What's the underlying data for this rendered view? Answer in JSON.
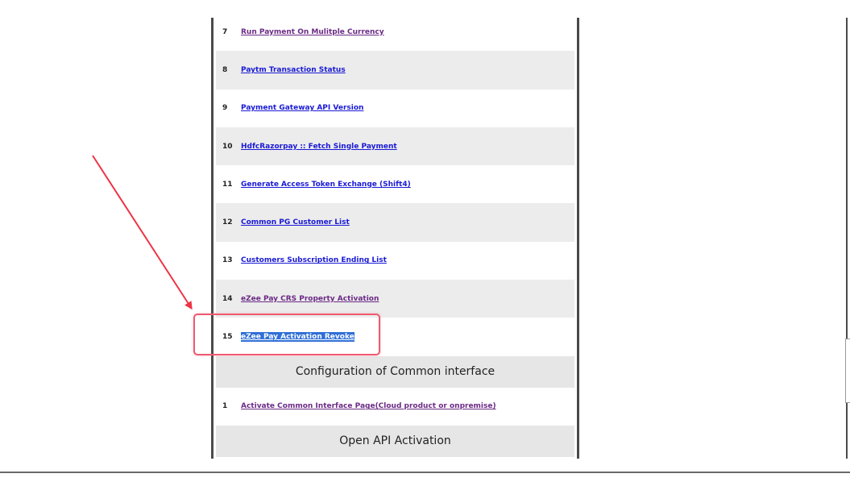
{
  "rows": [
    {
      "num": "7",
      "label": "Run Payment On Mulitple Currency"
    },
    {
      "num": "8",
      "label": "Paytm Transaction Status"
    },
    {
      "num": "9",
      "label": "Payment Gateway API Version"
    },
    {
      "num": "10",
      "label": "HdfcRazorpay :: Fetch Single Payment"
    },
    {
      "num": "11",
      "label": "Generate Access Token Exchange (Shift4)"
    },
    {
      "num": "12",
      "label": "Common PG Customer List"
    },
    {
      "num": "13",
      "label": "Customers Subscription Ending List"
    },
    {
      "num": "14",
      "label": "eZee Pay CRS Property Activation"
    },
    {
      "num": "15",
      "label": "eZee Pay Activation Revoke"
    }
  ],
  "sections": {
    "common_interface": {
      "title": "Configuration of Common interface",
      "rows": [
        {
          "num": "1",
          "label": "Activate Common Interface Page(Cloud product or onpremise)"
        }
      ]
    },
    "open_api": {
      "title": "Open API Activation"
    }
  },
  "colors": {
    "link_unvisited": "#1a1ad6",
    "link_visited": "#6b2a86",
    "selection": "#2f6fd6",
    "annotation": "#ee3344"
  }
}
